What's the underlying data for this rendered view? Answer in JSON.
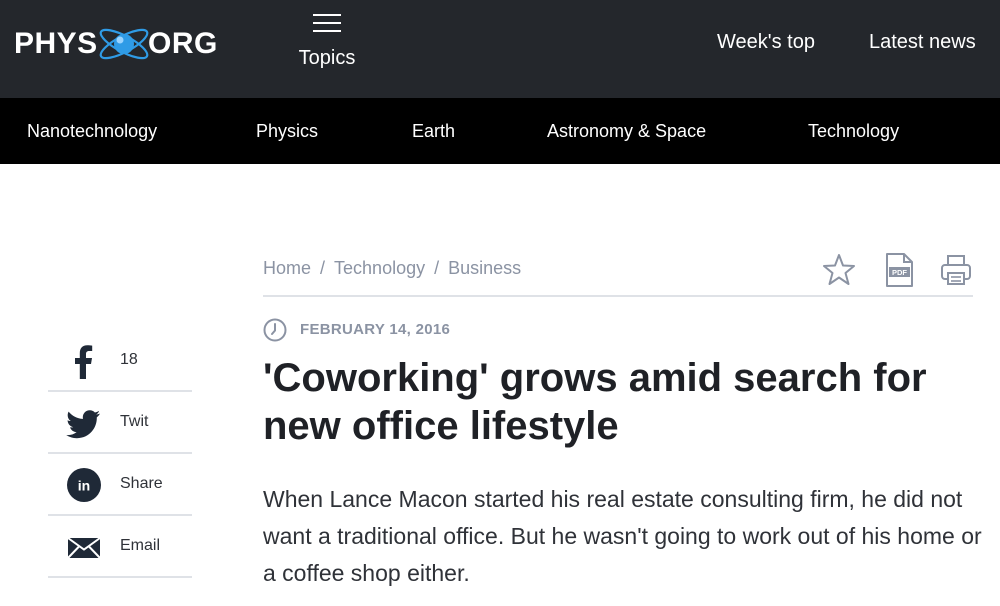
{
  "header": {
    "logo": {
      "left": "PHYS",
      "right": "ORG"
    },
    "topics_label": "Topics",
    "links": {
      "weeks_top": "Week's top",
      "latest_news": "Latest news"
    }
  },
  "categories": [
    "Nanotechnology",
    "Physics",
    "Earth",
    "Astronomy & Space",
    "Technology"
  ],
  "breadcrumb": [
    "Home",
    "Technology",
    "Business"
  ],
  "breadcrumb_separator": "/",
  "article": {
    "date": "FEBRUARY 14, 2016",
    "title": "'Coworking' grows amid search for new office lifestyle",
    "lead": "When Lance Macon started his real estate consulting firm, he did not want a traditional office. But he wasn't going to work out of his home or a coffee shop either."
  },
  "share": {
    "facebook": "18",
    "twitter": "Twit",
    "linkedin": "Share",
    "email": "Email"
  },
  "icons": [
    "atom-icon",
    "hamburger-icon",
    "star-icon",
    "pdf-icon",
    "print-icon",
    "clock-icon",
    "facebook-icon",
    "twitter-icon",
    "linkedin-icon",
    "email-icon"
  ],
  "colors": {
    "header_bg": "#24272c",
    "category_bar_bg": "#000000",
    "accent_blue": "#2f9be6",
    "muted_text": "#8b93a3",
    "dark_icon": "#1f2937"
  }
}
